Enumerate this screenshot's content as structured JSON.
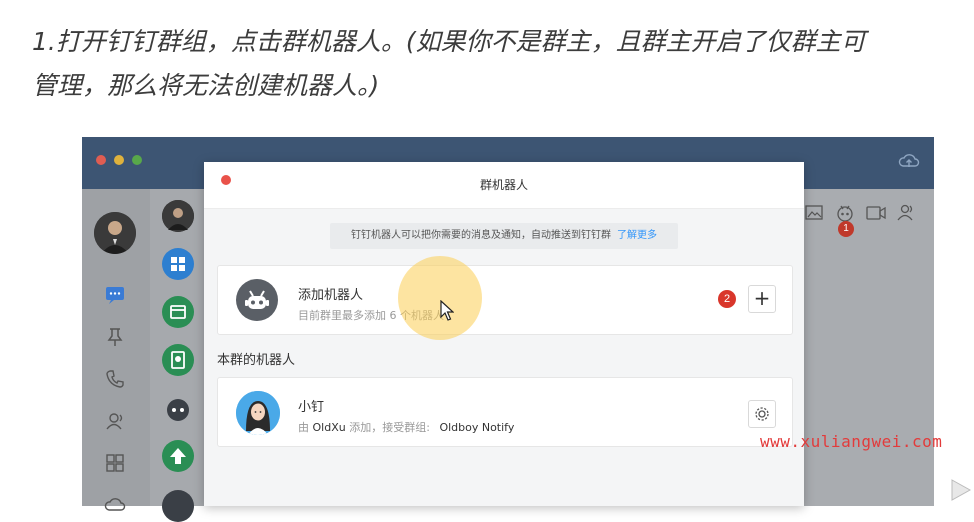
{
  "caption": {
    "line1": "1.打开钉钉群组，点击群机器人。(如果你不是群主，且群主开启了仅群主可",
    "line2": "管理，那么将无法创建机器人。)"
  },
  "app": {
    "colors": {
      "titlebar": "#3d5573",
      "background": "#a9acb0"
    },
    "right_toolbar": {
      "icons": [
        "image-icon",
        "robot-icon",
        "video-icon",
        "members-icon"
      ],
      "robot_badge": "1"
    }
  },
  "dialog": {
    "title": "群机器人",
    "notice_text": "钉钉机器人可以把你需要的消息及通知，自动推送到钉钉群",
    "notice_link": "了解更多",
    "add_card": {
      "title": "添加机器人",
      "subtitle": "目前群里最多添加 6 个机器人",
      "badge": "2",
      "plus": "+"
    },
    "section_label": "本群的机器人",
    "bot_card": {
      "name": "小钉",
      "sub_prefix": "由",
      "sub_owner": "OldXu",
      "sub_mid": "添加，接受群组:",
      "sub_group": "Oldboy Notify"
    }
  },
  "watermark": "www.xuliangwei.com"
}
